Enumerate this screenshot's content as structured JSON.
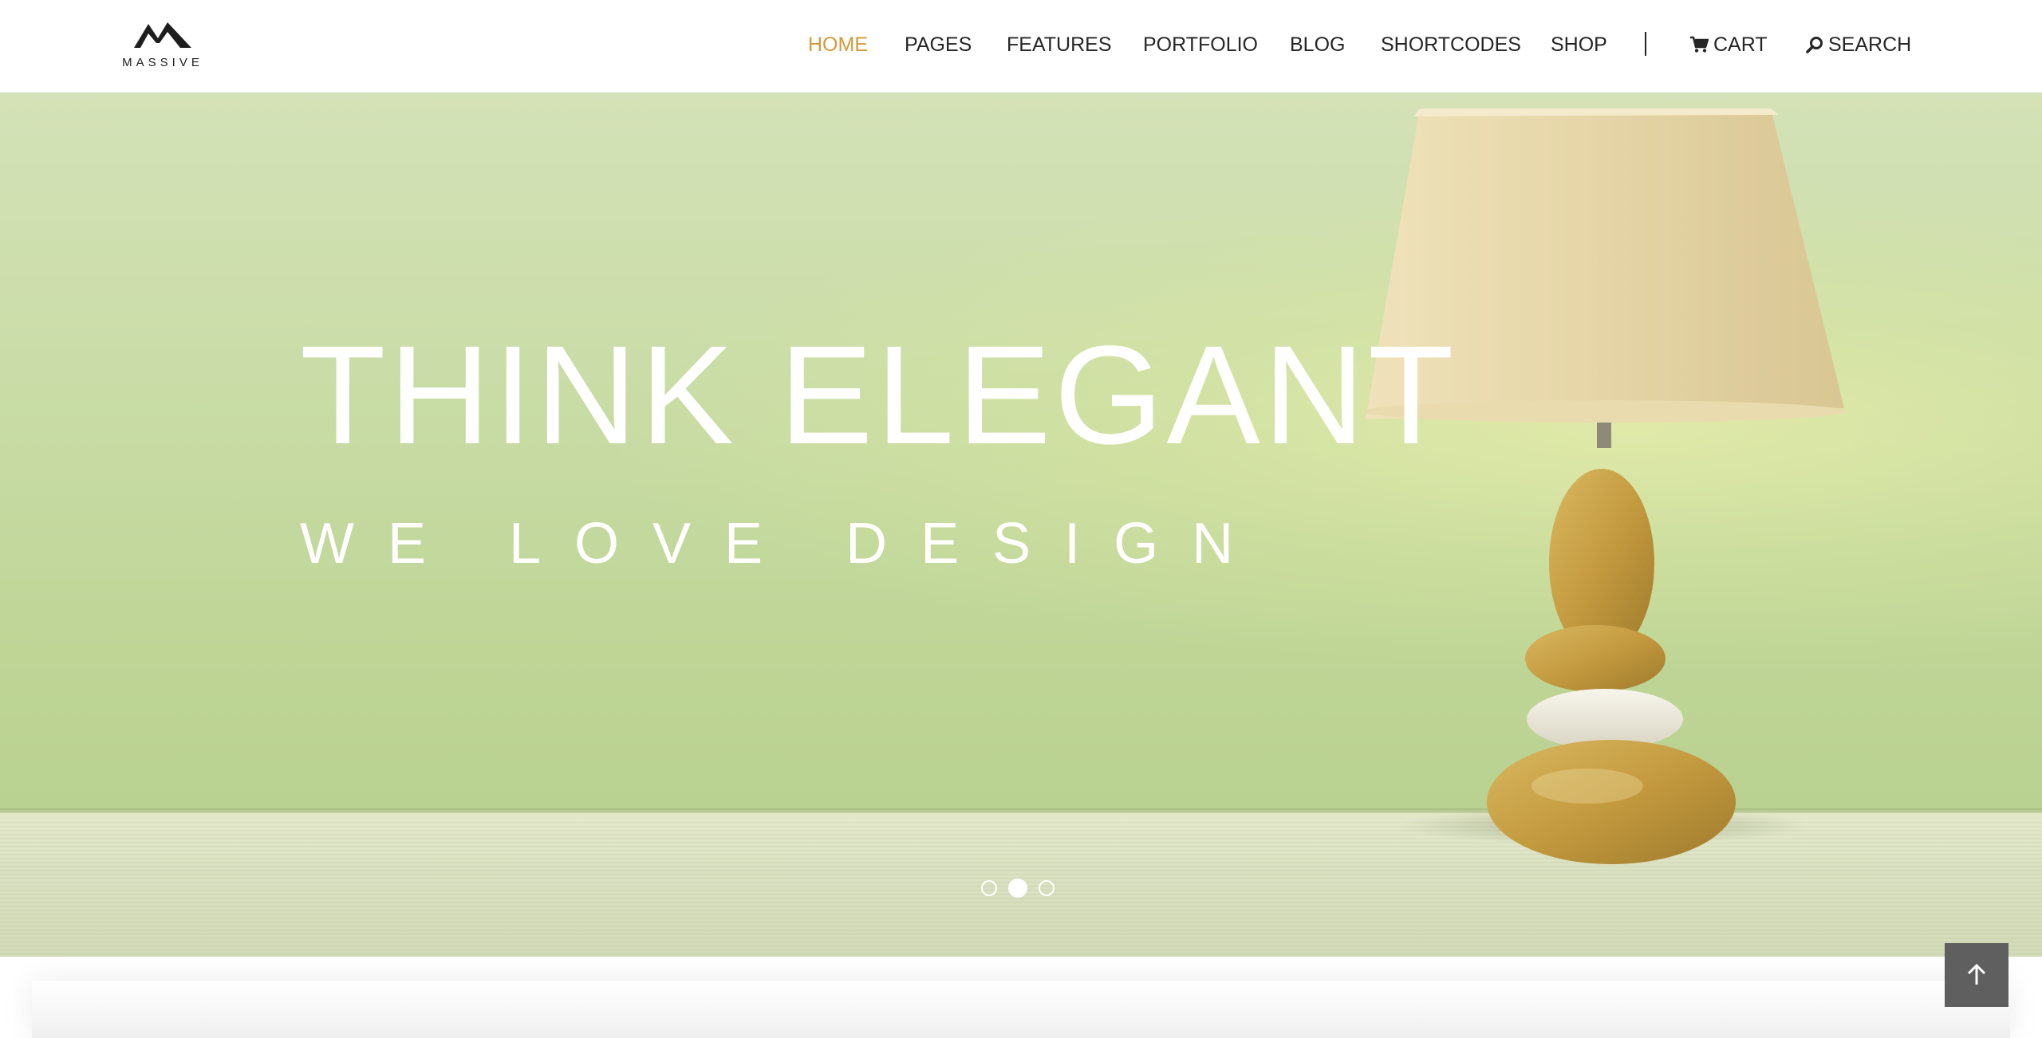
{
  "brand": {
    "name": "MASSIVE"
  },
  "nav": {
    "items": [
      {
        "label": "HOME",
        "active": true
      },
      {
        "label": "PAGES",
        "active": false
      },
      {
        "label": "FEATURES",
        "active": false
      },
      {
        "label": "PORTFOLIO",
        "active": false
      },
      {
        "label": "BLOG",
        "active": false
      },
      {
        "label": "SHORTCODES",
        "active": false
      },
      {
        "label": "SHOP",
        "active": false
      }
    ],
    "cart": {
      "label": "CART",
      "icon": "shopping-cart-icon"
    },
    "search": {
      "label": "SEARCH",
      "icon": "search-icon"
    }
  },
  "hero": {
    "title": "THINK ELEGANT",
    "subtitle": "WE LOVE DESIGN",
    "slides_total": 3,
    "active_slide": 2
  },
  "scroll_to_top": {
    "icon": "arrow-up-icon"
  },
  "colors": {
    "accent": "#d49a3a",
    "nav_text": "#262626",
    "hero_wall": "#c9dca6",
    "hero_text": "#ffffff",
    "to_top_bg": "#5f5f5f"
  }
}
